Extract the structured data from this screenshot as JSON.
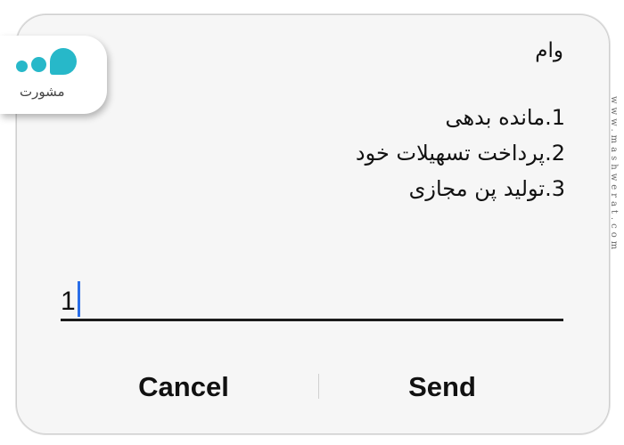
{
  "dialog": {
    "title": "وام",
    "menu_items": [
      "1.مانده بدهی",
      "2.پرداخت تسهیلات خود",
      "3.تولید پن مجازی"
    ],
    "input_value": "1",
    "cancel_label": "Cancel",
    "send_label": "Send"
  },
  "branding": {
    "logo_text": "مشورت",
    "side_url": "www.mashwerat.com",
    "accent_color": "#27b8c9"
  },
  "colors": {
    "caret": "#2a6ee8",
    "background": "#f6f6f6"
  }
}
